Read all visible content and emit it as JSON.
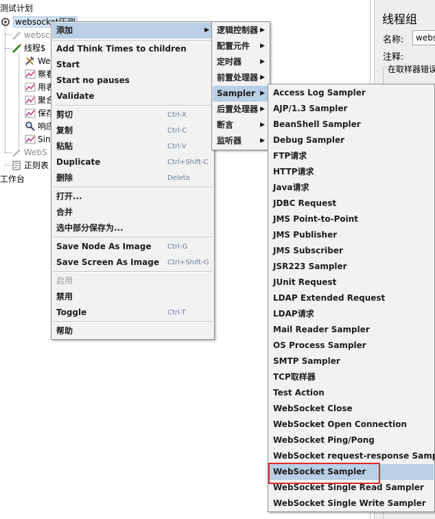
{
  "tree": {
    "root_label": "测试计划",
    "items": [
      {
        "label": "websocket压测"
      },
      {
        "label": "websc"
      },
      {
        "label": "线程$"
      },
      {
        "label": "We"
      },
      {
        "label": "察看"
      },
      {
        "label": "用表"
      },
      {
        "label": "聚合"
      },
      {
        "label": "保存"
      },
      {
        "label": "响应"
      },
      {
        "label": "Sin"
      },
      {
        "label": "WebS"
      },
      {
        "label": "正则表"
      },
      {
        "label": "工作台"
      }
    ]
  },
  "properties": {
    "title": "线程组",
    "name_label": "名称:",
    "name_value": "websocket",
    "comment_label": "注释:",
    "group_label": "在取样器错误"
  },
  "context_menu": {
    "add": "添加",
    "add_think_times": "Add Think Times to children",
    "start": "Start",
    "start_no_pauses": "Start no pauses",
    "validate": "Validate",
    "cut": "剪切",
    "cut_acc": "Ctrl-X",
    "copy": "复制",
    "copy_acc": "Ctrl-C",
    "paste": "粘贴",
    "paste_acc": "Ctrl-V",
    "duplicate": "Duplicate",
    "duplicate_acc": "Ctrl+Shift-C",
    "delete": "删除",
    "delete_acc": "Delete",
    "open": "打开...",
    "merge": "合并",
    "save_selection": "选中部分保存为...",
    "save_node_image": "Save Node As Image",
    "save_node_image_acc": "Ctrl-G",
    "save_screen_image": "Save Screen As Image",
    "save_screen_image_acc": "Ctrl+Shift-G",
    "enable": "启用",
    "disable": "禁用",
    "toggle": "Toggle",
    "toggle_acc": "Ctrl-T",
    "help": "帮助"
  },
  "add_menu": {
    "items": [
      "逻辑控制器",
      "配置元件",
      "定时器",
      "前置处理器",
      "Sampler",
      "后置处理器",
      "断言",
      "监听器"
    ]
  },
  "sampler_menu": {
    "items": [
      "Access Log Sampler",
      "AJP/1.3 Sampler",
      "BeanShell Sampler",
      "Debug Sampler",
      "FTP请求",
      "HTTP请求",
      "Java请求",
      "JDBC Request",
      "JMS Point-to-Point",
      "JMS Publisher",
      "JMS Subscriber",
      "JSR223 Sampler",
      "JUnit Request",
      "LDAP Extended Request",
      "LDAP请求",
      "Mail Reader Sampler",
      "OS Process Sampler",
      "SMTP Sampler",
      "TCP取样器",
      "Test Action",
      "WebSocket Close",
      "WebSocket Open Connection",
      "WebSocket Ping/Pong",
      "WebSocket request-response Sampler",
      "WebSocket Sampler",
      "WebSocket Single Read Sampler",
      "WebSocket Single Write Sampler"
    ],
    "highlighted": "WebSocket Sampler"
  },
  "colors": {
    "highlight": "#b8cfe5",
    "annotation_box": "#e0282a",
    "menu_background": "#f2f2f2"
  }
}
